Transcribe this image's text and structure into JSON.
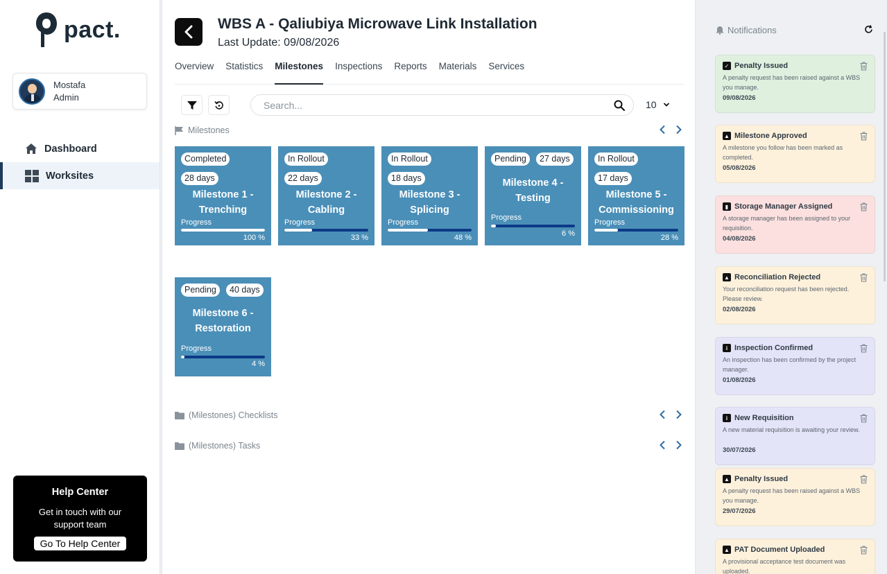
{
  "brand": {
    "name": "pact."
  },
  "user": {
    "name": "Mostafa",
    "role": "Admin"
  },
  "nav": [
    {
      "label": "Dashboard",
      "icon": "home-icon"
    },
    {
      "label": "Worksites",
      "icon": "grid-icon"
    }
  ],
  "help": {
    "title": "Help Center",
    "text": "Get in touch with our support team",
    "button": "Go To Help Center"
  },
  "header": {
    "title": "WBS A - Qaliubiya Microwave Link Installation",
    "subtitle": "Last Update: 09/08/2026"
  },
  "tabs": [
    "Overview",
    "Statistics",
    "Milestones",
    "Inspections",
    "Reports",
    "Materials",
    "Services"
  ],
  "search": {
    "placeholder": "Search..."
  },
  "page_size": "10",
  "sections": {
    "milestones": "Milestones",
    "checklists": "(Milestones) Checklists",
    "tasks": "(Milestones) Tasks"
  },
  "milestones": [
    {
      "status": "Completed",
      "days": "28 days",
      "title1": "Milestone 1 -",
      "title2": "Trenching",
      "progress_label": "Progress",
      "progress": 1.0,
      "pct": "100 %"
    },
    {
      "status": "In Rollout",
      "days": "22 days",
      "title1": "Milestone 2 -",
      "title2": "Cabling",
      "progress_label": "Progress",
      "progress": 0.33,
      "pct": "33 %"
    },
    {
      "status": "In Rollout",
      "days": "18 days",
      "title1": "Milestone 3 -",
      "title2": "Splicing",
      "progress_label": "Progress",
      "progress": 0.48,
      "pct": "48 %"
    },
    {
      "status": "Pending",
      "days": "27 days",
      "title1": "Milestone 4 -",
      "title2": "Testing",
      "progress_label": "Progress",
      "progress": 0.06,
      "pct": "6 %"
    },
    {
      "status": "In Rollout",
      "days": "17 days",
      "title1": "Milestone 5 -",
      "title2": "Commissioning",
      "progress_label": "Progress",
      "progress": 0.28,
      "pct": "28 %"
    },
    {
      "status": "Pending",
      "days": "40 days",
      "title1": "Milestone 6 -",
      "title2": "Restoration",
      "progress_label": "Progress",
      "progress": 0.04,
      "pct": "4 %"
    }
  ],
  "notifications_title": "Notifications",
  "notifications": [
    {
      "title": "Penalty Issued",
      "msg": "A penalty request has been raised against a WBS you manage.",
      "date": "09/08/2026",
      "bg": "#dff0df",
      "glyph": "✓"
    },
    {
      "title": "Milestone Approved",
      "msg": "A milestone you follow has been marked as completed.",
      "date": "05/08/2026",
      "bg": "#fdf1dc",
      "glyph": "▲"
    },
    {
      "title": "Storage Manager Assigned",
      "msg": "A storage manager has been assigned to your requisition.",
      "date": "04/08/2026",
      "bg": "#fbe0df",
      "glyph": "▮"
    },
    {
      "title": "Reconciliation Rejected",
      "msg": "Your reconciliation request has been rejected. Please review.",
      "date": "02/08/2026",
      "bg": "#fdf1dc",
      "glyph": "▲"
    },
    {
      "title": "Inspection Confirmed",
      "msg": "An inspection has been confirmed by the project manager.",
      "date": "01/08/2026",
      "bg": "#e4e4f8",
      "glyph": "i"
    },
    {
      "title": "New Requisition",
      "msg": "A new material requisition is awaiting your review.",
      "date": "30/07/2026",
      "bg": "#e4e4f8",
      "glyph": "i"
    },
    {
      "title": "Penalty Issued",
      "msg": "A penalty request has been raised against a WBS you manage.",
      "date": "29/07/2026",
      "bg": "#fdf1dc",
      "glyph": "▲"
    },
    {
      "title": "PAT Document Uploaded",
      "msg": "A provisional acceptance test document was uploaded.",
      "date": "",
      "bg": "#fdf1dc",
      "glyph": "▲"
    }
  ],
  "colors": {
    "card": "#4a8fb8",
    "bar_track": "#0c3a86",
    "dark": "#0d0d0d"
  }
}
